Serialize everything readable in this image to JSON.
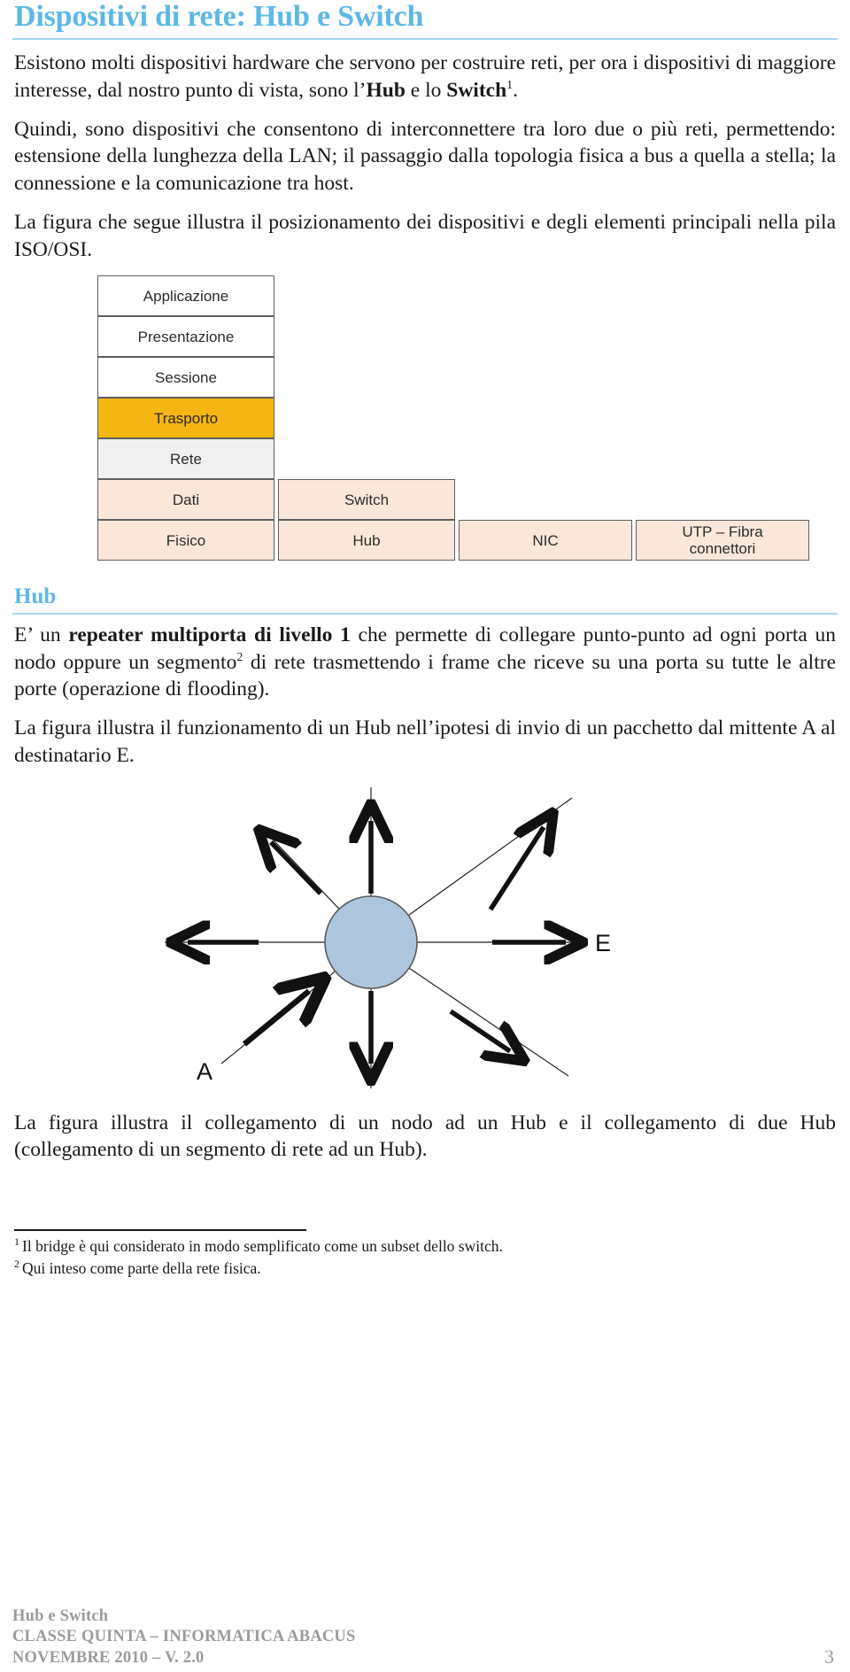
{
  "document": {
    "title": "Dispositivi di rete: Hub e Switch",
    "accent_color": "#5CB8E6",
    "intro_paragraph_part1": "Esistono molti dispositivi hardware che servono per costruire reti, per ora i dispositivi di maggiore interesse, dal nostro punto di vista, sono l’",
    "intro_bold_hub": "Hub",
    "intro_paragraph_part2": " e lo ",
    "intro_bold_switch": "Switch",
    "intro_footnote_marker": "1",
    "intro_paragraph_end": ".",
    "paragraph_2": "Quindi, sono dispositivi che consentono di interconnettere tra loro due o più reti, permettendo: estensione della lunghezza della LAN; il passaggio dalla topologia fisica a bus a quella a stella; la connessione e la comunicazione tra host.",
    "paragraph_3": "La figura che segue illustra il posizionamento dei dispositivi e degli elementi principali nella pila ISO/OSI."
  },
  "osi_figure": {
    "name": "Pila ISO/OSI",
    "colors": {
      "white": "#ffffff",
      "orange": "#f5b513",
      "grey": "#f0f0f0",
      "peach": "#fbe7d9",
      "border": "#5e5e5e"
    },
    "layers": [
      {
        "label": "Applicazione",
        "fill": "white"
      },
      {
        "label": "Presentazione",
        "fill": "white"
      },
      {
        "label": "Sessione",
        "fill": "white"
      },
      {
        "label": "Trasporto",
        "fill": "orange"
      },
      {
        "label": "Rete",
        "fill": "grey"
      },
      {
        "label": "Dati",
        "fill": "peach"
      },
      {
        "label": "Fisico",
        "fill": "peach"
      }
    ],
    "devices": [
      {
        "label": "Switch",
        "fill": "peach"
      },
      {
        "label": "Hub",
        "fill": "peach"
      }
    ],
    "nic": {
      "label": "NIC",
      "fill": "peach"
    },
    "media": {
      "line1": "UTP – Fibra",
      "line2": "connettori",
      "fill": "peach"
    }
  },
  "hub_section": {
    "heading": "Hub",
    "para1_start": "E’ un ",
    "para1_bold": "repeater multiporta di livello 1",
    "para1_mid": " che permette di collegare punto-punto ad ogni porta un nodo oppure un segmento",
    "para1_footnote_marker": "2",
    "para1_end": " di rete trasmettendo i frame che riceve su una porta su tutte le altre porte (operazione di flooding).",
    "para2": "La figura illustra il funzionamento di un Hub nell’ipotesi di invio di un pacchetto dal mittente A al destinatario E.",
    "para3": "La figura illustra il collegamento di un nodo ad un Hub e il collegamento di due Hub (collegamento di un segmento di rete ad un Hub)."
  },
  "hub_diagram": {
    "hub_fill": "#aec6dd",
    "hub_stroke": "#5a5a5a",
    "sender_label": "A",
    "receiver_label": "E",
    "spoke_count": 8,
    "description": "Hub a stella con 8 raggi: freccia entrante dal basso-sinistra (A), frecce uscenti verso gli altri 7 raggi"
  },
  "footnotes": [
    {
      "marker": "1",
      "text": "Il bridge è qui considerato in modo semplificato come un subset dello switch."
    },
    {
      "marker": "2",
      "text": "Qui inteso come parte della rete fisica."
    }
  ],
  "footer": {
    "line1": "Hub e Switch",
    "line2": "CLASSE QUINTA – INFORMATICA ABACUS",
    "line3": "NOVEMBRE 2010 – V. 2.0",
    "page_number": "3",
    "color": "#9b9b9b"
  }
}
